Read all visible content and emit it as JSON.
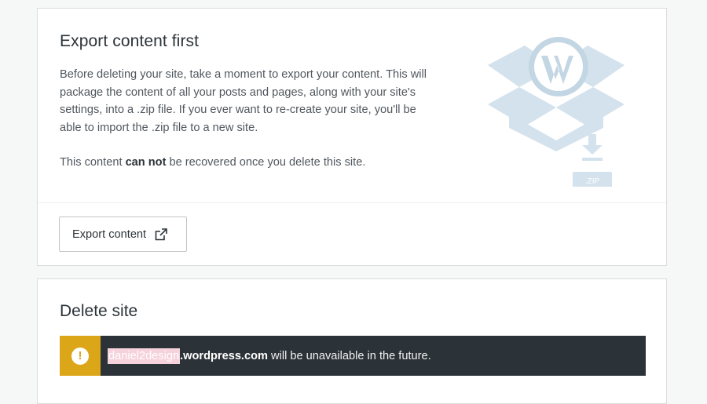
{
  "export_card": {
    "title": "Export content first",
    "description": "Before deleting your site, take a moment to export your content. This will package the content of all your posts and pages, along with your site's settings, into a .zip file. If you ever want to re-create your site, you'll be able to import the .zip file to a new site.",
    "warning_prefix": "This content ",
    "warning_emphasis": "can not",
    "warning_suffix": " be recovered once you delete this site.",
    "illustration_label": ".ZIP",
    "button_label": "Export content",
    "button_icon": "external-link-icon"
  },
  "delete_card": {
    "title": "Delete site",
    "notice": {
      "icon": "alert-icon",
      "icon_glyph": "!",
      "site_name": "daniel2design",
      "domain_suffix": ".wordpress.com",
      "message": " will be unavailable in the future."
    }
  },
  "colors": {
    "page_background": "#f6f7f7",
    "card_background": "#ffffff",
    "notice_background": "#2c3338",
    "notice_accent": "#dba617",
    "illustration": "#c3d6e3"
  }
}
